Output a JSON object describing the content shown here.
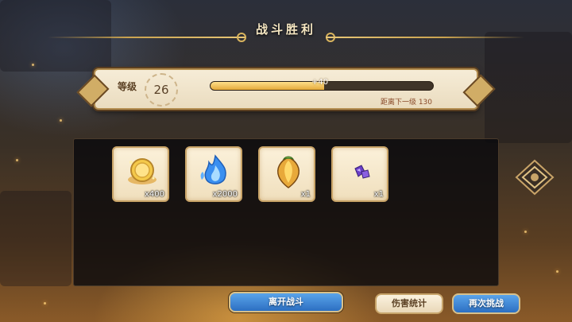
{
  "title": "战斗胜利",
  "level": {
    "label": "等级",
    "value": "26",
    "xp_gain": "+40",
    "xp_progress": 0.51,
    "next_level_text": "距离下一级  130"
  },
  "rewards": [
    {
      "icon": "gold-coin-icon",
      "quantity": "x400"
    },
    {
      "icon": "blue-flame-icon",
      "quantity": "x2000"
    },
    {
      "icon": "golden-seed-icon",
      "quantity": "x1"
    },
    {
      "icon": "purple-gem-icon",
      "quantity": "x1"
    }
  ],
  "buttons": {
    "leave": "离开战斗",
    "damage_stats": "伤害统计",
    "retry": "再次挑战"
  },
  "colors": {
    "gold_accent": "#c9a24f",
    "button_blue": "#2c6fc2",
    "parchment": "#f6ecd7"
  }
}
